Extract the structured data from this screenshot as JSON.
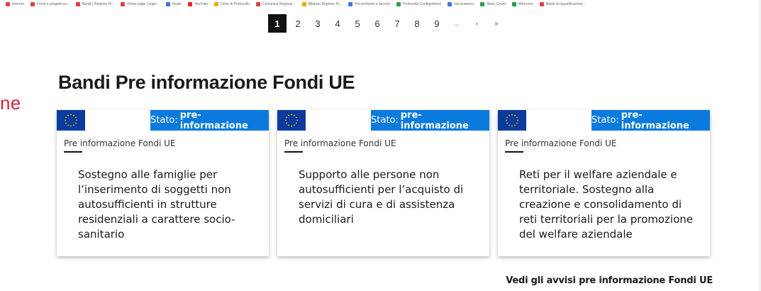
{
  "bookmarks": [
    {
      "label": "Internet",
      "color": "#d44"
    },
    {
      "label": "Fondi e progetti eu...",
      "color": "#d44"
    },
    {
      "label": "Bandi | Regione Pi...",
      "color": "#d44"
    },
    {
      "label": "Home page | regio...",
      "color": "#d44"
    },
    {
      "label": "Gmail",
      "color": "#3a78d8"
    },
    {
      "label": "YouTube",
      "color": "#e22"
    },
    {
      "label": "Drive di Protocollo",
      "color": "#f2a900"
    },
    {
      "label": "Comunica Regione...",
      "color": "#d44"
    },
    {
      "label": "Bilancio Regione Pi...",
      "color": "#f2a900"
    },
    {
      "label": "Pre-richieste e Vacche",
      "color": "#3a78d8"
    },
    {
      "label": "Protocollo Contigestione",
      "color": "#2a9d4a"
    },
    {
      "label": "Vaccinazioni",
      "color": "#3a78d8"
    },
    {
      "label": "Stats_Covid",
      "color": "#2a9d4a"
    },
    {
      "label": "Welcome",
      "color": "#2a9d4a"
    },
    {
      "label": "Bandi di riqualificazione...",
      "color": "#d44"
    }
  ],
  "pagination": {
    "pages": [
      "1",
      "2",
      "3",
      "4",
      "5",
      "6",
      "7",
      "8",
      "9"
    ],
    "current": "1",
    "ellipsis": "...",
    "next": "›",
    "last": "»"
  },
  "left_cutoff_text": "ne",
  "section_title": "Bandi Pre informazione Fondi UE",
  "cards": [
    {
      "status_label": "Stato:",
      "status_value": "pre-informazione",
      "category": "Pre informazione Fondi UE",
      "text": "Sostegno alle famiglie per l’inserimento di soggetti non autosufficienti in strutture residenziali a carattere socio-sanitario"
    },
    {
      "status_label": "Stato:",
      "status_value": "pre-informazione",
      "category": "Pre informazione Fondi UE",
      "text": "Supporto alle persone non autosufficienti per l’acquisto di servizi di cura e di assistenza domiciliari"
    },
    {
      "status_label": "Stato:",
      "status_value": "pre-informazione",
      "category": "Pre informazione Fondi UE",
      "text": "Reti per il welfare aziendale e territoriale. Sostegno alla creazione e consolidamento di reti territoriali per la promozione del welfare aziendale"
    }
  ],
  "see_all_link": "Vedi gli avvisi pre informazione Fondi UE",
  "colors": {
    "status_badge": "#0a7bdc",
    "eu_flag": "#0b3b9c",
    "eu_stars": "#ffcc00",
    "cutoff_text": "#d4243a",
    "active_page": "#111111"
  }
}
